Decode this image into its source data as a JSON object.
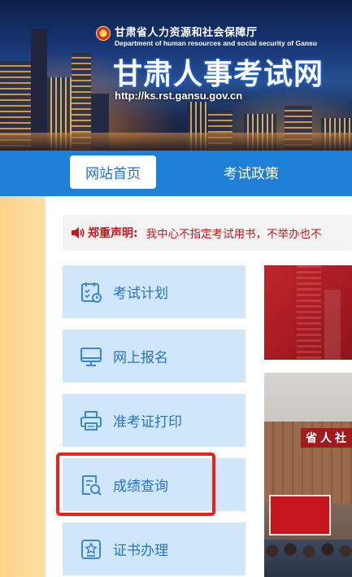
{
  "banner": {
    "dept_cn": "甘肃省人力资源和社会保障厅",
    "dept_en": "Department of human resources and social security of Gansu",
    "site_title": "甘肃人事考试网",
    "site_url": "http://ks.rst.gansu.gov.cn"
  },
  "nav": {
    "items": [
      {
        "label": "网站首页",
        "active": true
      },
      {
        "label": "考试政策",
        "active": false
      }
    ]
  },
  "notice": {
    "icon": "speaker-icon",
    "label": "郑重声明:",
    "text": "我中心不指定考试用书，不举办也不"
  },
  "side_menu": {
    "items": [
      {
        "label": "考试计划",
        "icon": "calendar-check-icon"
      },
      {
        "label": "网上报名",
        "icon": "monitor-icon"
      },
      {
        "label": "准考证打印",
        "icon": "printer-icon"
      },
      {
        "label": "成绩查询",
        "icon": "document-search-icon",
        "highlighted": true
      },
      {
        "label": "证书办理",
        "icon": "certificate-icon"
      }
    ]
  },
  "images": {
    "meeting_banner_text": "省人社"
  },
  "colors": {
    "nav_bg": "#1e7fd6",
    "menu_bg": "#cfe6fb",
    "menu_text": "#2a72c4",
    "notice_red": "#c8161d",
    "highlight_red": "#e8231a"
  }
}
